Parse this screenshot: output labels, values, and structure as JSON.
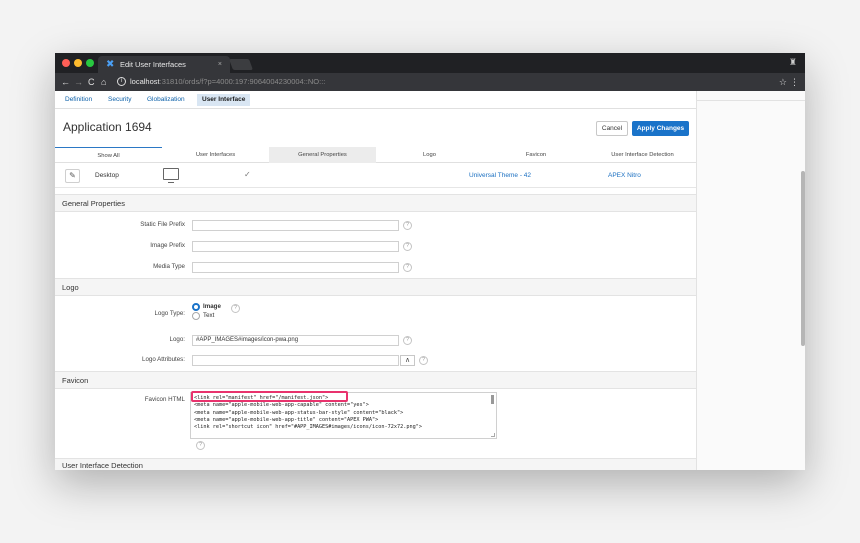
{
  "browser": {
    "tab_title": "Edit User Interfaces",
    "tab_close": "×",
    "tab_icon": "apex-icon",
    "url_host": "localhost",
    "url_path": ":31810/ords/f?p=4000:197:9064004230004::NO:::",
    "back": "←",
    "forward": "→",
    "reload": "C",
    "home": "⌂",
    "info": "i",
    "star": "☆",
    "menu": "⋮",
    "profile": "♜"
  },
  "section_tabs": [
    "Definition",
    "Security",
    "Globalization",
    "User Interface"
  ],
  "page_title": "Application 1694",
  "buttons": {
    "cancel": "Cancel",
    "apply": "Apply Changes"
  },
  "grid": {
    "headers": [
      "Show All",
      "User Interfaces",
      "General Properties",
      "Logo",
      "Favicon",
      "User Interface Detection"
    ],
    "row": {
      "edit": "✎",
      "name": "Desktop",
      "check": "✓",
      "theme": "Universal Theme - 42",
      "detection": "APEX Nitro"
    }
  },
  "general_properties": {
    "heading": "General Properties",
    "static_file_prefix": {
      "label": "Static File Prefix",
      "value": ""
    },
    "image_prefix": {
      "label": "Image Prefix",
      "value": ""
    },
    "media_type": {
      "label": "Media Type",
      "value": ""
    }
  },
  "logo": {
    "heading": "Logo",
    "type_label": "Logo Type:",
    "type_options": [
      "Image",
      "Text"
    ],
    "selected": "Image",
    "logo_label": "Logo:",
    "logo_value": "#APP_IMAGES#images/icon-pwa.png",
    "attributes_label": "Logo Attributes:",
    "attributes_value": "",
    "popup": "∧"
  },
  "favicon": {
    "heading": "Favicon",
    "html_label": "Favicon HTML",
    "lines": [
      "<link rel=\"manifest\" href=\"/manifest.json\">",
      "<meta name=\"apple-mobile-web-app-capable\" content=\"yes\">",
      "<meta name=\"apple-mobile-web-app-status-bar-style\" content=\"black\">",
      "<meta name=\"apple-mobile-web-app-title\" content=\"APEX PWA\">",
      "<link rel=\"shortcut icon\" href=\"#APP_IMAGES#images/icons/icon-72x72.png\">"
    ]
  },
  "detection_heading": "User Interface Detection",
  "help_glyph": "?",
  "colors": {
    "accent": "#1a73c9",
    "highlight": "#e8336d",
    "chrome_dark": "#202124"
  }
}
